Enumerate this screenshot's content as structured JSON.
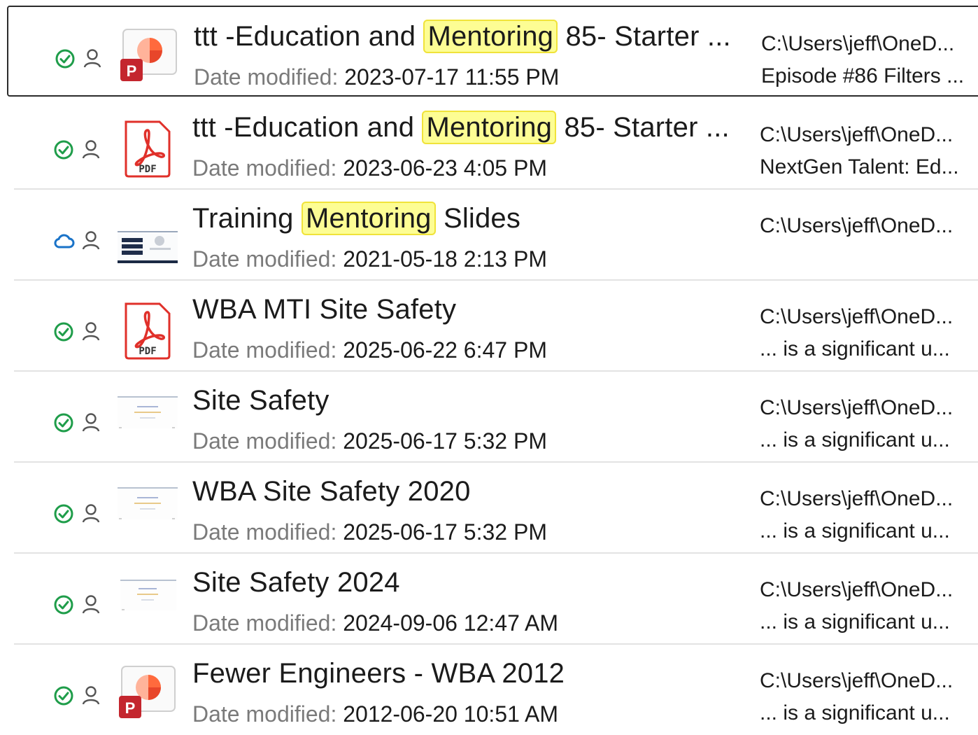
{
  "results": [
    {
      "type": "pptx",
      "status": "synced",
      "title_pre": "ttt -Education and ",
      "title_hl": "Mentoring",
      "title_post": " 85- Starter ...",
      "date_label": "Date modified:",
      "date": "2023-07-17 11:55 PM",
      "path": "C:\\Users\\jeff\\OneD...",
      "snippet": "Episode #86 Filters ..."
    },
    {
      "type": "pdf",
      "status": "synced",
      "title_pre": "ttt -Education and ",
      "title_hl": "Mentoring",
      "title_post": " 85- Starter ...",
      "date_label": "Date modified:",
      "date": "2023-06-23 4:05 PM",
      "path": "C:\\Users\\jeff\\OneD...",
      "snippet": "NextGen Talent: Ed..."
    },
    {
      "type": "slides-thumb",
      "status": "cloud",
      "title_pre": "Training ",
      "title_hl": "Mentoring",
      "title_post": " Slides",
      "date_label": "Date modified:",
      "date": "2021-05-18 2:13 PM",
      "path": "C:\\Users\\jeff\\OneD...",
      "snippet": ""
    },
    {
      "type": "pdf",
      "status": "synced",
      "title_pre": "WBA MTI Site Safety",
      "title_hl": "",
      "title_post": "",
      "date_label": "Date modified:",
      "date": "2025-06-22 6:47 PM",
      "path": "C:\\Users\\jeff\\OneD...",
      "snippet": "... is a significant u..."
    },
    {
      "type": "doc-thumb",
      "status": "synced",
      "title_pre": "Site Safety",
      "title_hl": "",
      "title_post": "",
      "date_label": "Date modified:",
      "date": "2025-06-17 5:32 PM",
      "path": "C:\\Users\\jeff\\OneD...",
      "snippet": "... is a significant u..."
    },
    {
      "type": "doc-thumb",
      "status": "synced",
      "title_pre": "WBA Site Safety 2020",
      "title_hl": "",
      "title_post": "",
      "date_label": "Date modified:",
      "date": "2025-06-17 5:32 PM",
      "path": "C:\\Users\\jeff\\OneD...",
      "snippet": "... is a significant u..."
    },
    {
      "type": "doc-thumb",
      "status": "synced",
      "title_pre": "Site Safety 2024",
      "title_hl": "",
      "title_post": "",
      "date_label": "Date modified:",
      "date": "2024-09-06 12:47 AM",
      "path": "C:\\Users\\jeff\\OneD...",
      "snippet": "... is a significant u..."
    },
    {
      "type": "pptx",
      "status": "synced",
      "title_pre": "Fewer Engineers - WBA 2012",
      "title_hl": "",
      "title_post": "",
      "date_label": "Date modified:",
      "date": "2012-06-20 10:51 AM",
      "path": "C:\\Users\\jeff\\OneD...",
      "snippet": "... is a significant u..."
    }
  ],
  "colors": {
    "synced": "#1f9d4a",
    "cloud": "#1a73c8",
    "highlight": "#fdfd94"
  }
}
